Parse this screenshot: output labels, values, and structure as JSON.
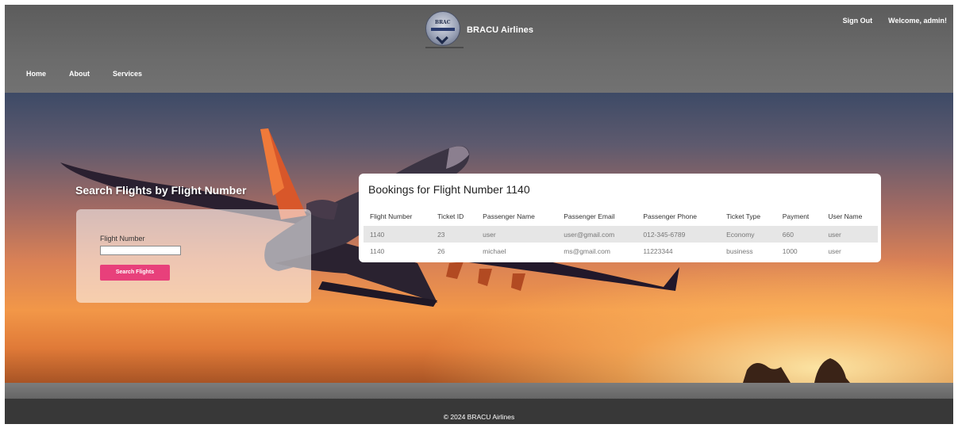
{
  "header": {
    "brand": "BRACU Airlines",
    "logo_text": "BRAC",
    "sign_out": "Sign Out",
    "welcome": "Welcome, admin!",
    "nav": [
      "Home",
      "About",
      "Services"
    ]
  },
  "search": {
    "title": "Search Flights by Flight Number",
    "field_label": "Flight Number",
    "field_value": "",
    "button": "Search Flights"
  },
  "bookings": {
    "title": "Bookings for Flight Number 1140",
    "columns": [
      "Flight Number",
      "Ticket ID",
      "Passenger Name",
      "Passenger Email",
      "Passenger Phone",
      "Ticket Type",
      "Payment",
      "User Name"
    ],
    "rows": [
      [
        "1140",
        "23",
        "user",
        "user@gmail.com",
        "012-345-6789",
        "Economy",
        "660",
        "user"
      ],
      [
        "1140",
        "26",
        "michael",
        "ms@gmail.com",
        "11223344",
        "business",
        "1000",
        "user"
      ]
    ]
  },
  "footer": {
    "copyright": "© 2024 BRACU Airlines"
  },
  "colors": {
    "accent": "#e8407b",
    "header": "#6b6b6b",
    "footer": "#383838"
  }
}
